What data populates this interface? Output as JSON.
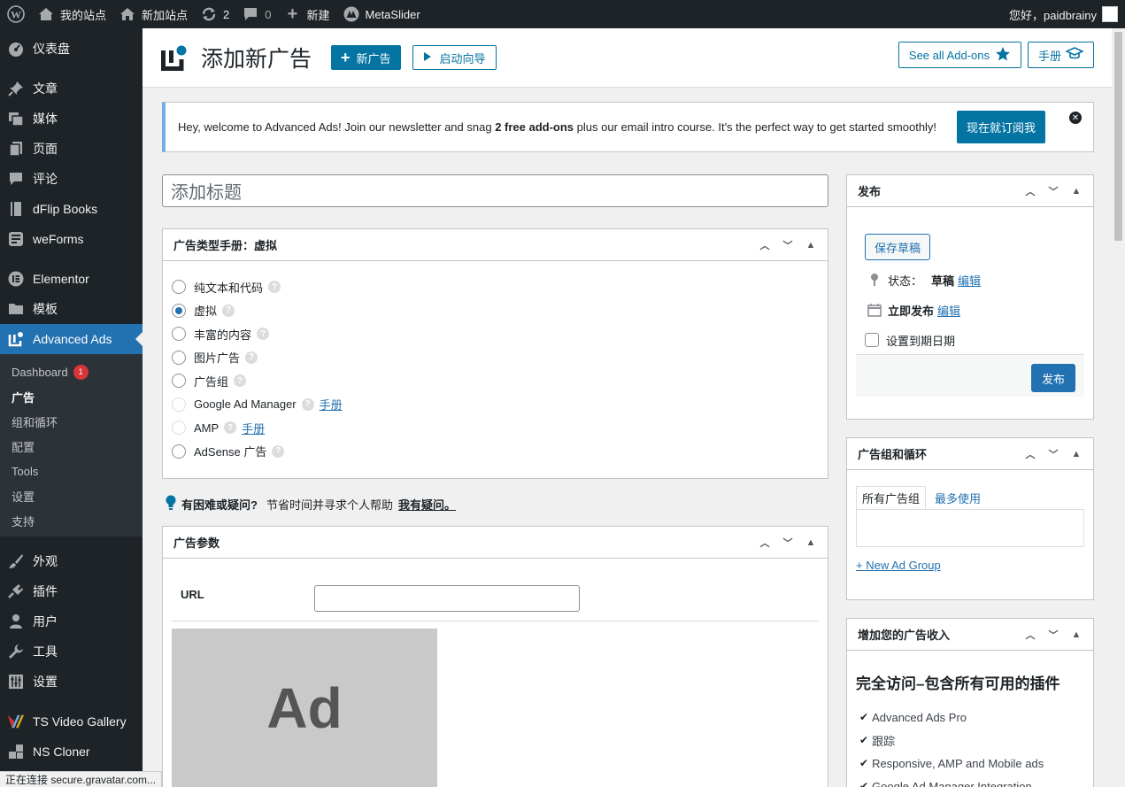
{
  "adminbar": {
    "site_name": "我的站点",
    "new_site": "新加站点",
    "updates": "2",
    "comments": "0",
    "new": "新建",
    "metaslider": "MetaSlider",
    "greeting": "您好，paidbrainy"
  },
  "sidebar": {
    "items": [
      {
        "label": "仪表盘",
        "icon": "dashboard-icon"
      },
      {
        "label": "文章",
        "icon": "pin-icon"
      },
      {
        "label": "媒体",
        "icon": "media-icon"
      },
      {
        "label": "页面",
        "icon": "page-icon"
      },
      {
        "label": "评论",
        "icon": "comment-icon"
      },
      {
        "label": "dFlip Books",
        "icon": "book-icon"
      },
      {
        "label": "weForms",
        "icon": "forms-icon"
      },
      {
        "label": "Elementor",
        "icon": "elementor-icon"
      },
      {
        "label": "模板",
        "icon": "folder-icon"
      },
      {
        "label": "Advanced Ads",
        "icon": "advanced-ads-icon"
      }
    ],
    "submenu": [
      {
        "label": "Dashboard",
        "badge": "1"
      },
      {
        "label": "广告"
      },
      {
        "label": "组和循环"
      },
      {
        "label": "配置"
      },
      {
        "label": "Tools"
      },
      {
        "label": "设置"
      },
      {
        "label": "支持"
      }
    ],
    "items2": [
      {
        "label": "外观",
        "icon": "brush-icon"
      },
      {
        "label": "插件",
        "icon": "plugin-icon"
      },
      {
        "label": "用户",
        "icon": "user-icon"
      },
      {
        "label": "工具",
        "icon": "wrench-icon"
      },
      {
        "label": "设置",
        "icon": "settings-icon"
      },
      {
        "label": "TS Video Gallery",
        "icon": "video-gallery-icon"
      },
      {
        "label": "NS Cloner",
        "icon": "cloner-icon"
      }
    ]
  },
  "header": {
    "title": "添加新广告",
    "new_ad": "新广告",
    "wizard": "启动向导",
    "addons": "See all Add-ons",
    "manual": "手册"
  },
  "notice": {
    "text_pre": "Hey, welcome to Advanced Ads! Join our newsletter and snag ",
    "text_bold": "2 free add-ons",
    "text_post": " plus our email intro course. It's the perfect way to get started smoothly!",
    "button": "现在就订阅我"
  },
  "title_placeholder": "添加标题",
  "ad_type": {
    "heading": "广告类型手册：虚拟",
    "options": [
      {
        "label": "纯文本和代码",
        "state": "unchecked"
      },
      {
        "label": "虚拟",
        "state": "checked"
      },
      {
        "label": "丰富的内容",
        "state": "unchecked"
      },
      {
        "label": "图片广告",
        "state": "unchecked"
      },
      {
        "label": "广告组",
        "state": "unchecked"
      },
      {
        "label": "Google Ad Manager",
        "state": "disabled",
        "link": "手册"
      },
      {
        "label": "AMP",
        "state": "disabled",
        "link": "手册"
      },
      {
        "label": "AdSense 广告",
        "state": "unchecked"
      }
    ]
  },
  "hint": {
    "bold": "有困难或疑问?",
    "text": "节省时间并寻求个人帮助",
    "link": "我有疑问。"
  },
  "ad_params": {
    "heading": "广告参数",
    "url_label": "URL",
    "url_value": "",
    "placeholder_text": "Ad"
  },
  "publish": {
    "heading": "发布",
    "save_draft": "保存草稿",
    "status_label": "状态：",
    "status_value": "草稿",
    "edit": "编辑",
    "publish_now": "立即发布",
    "expiry": "设置到期日期",
    "publish_btn": "发布"
  },
  "groups": {
    "heading": "广告组和循环",
    "tab_all": "所有广告组",
    "tab_recent": "最多使用",
    "new_group": "+ New Ad Group"
  },
  "revenue": {
    "heading": "增加您的广告收入",
    "subheading": "完全访问–包含所有可用的插件",
    "features": [
      "Advanced Ads Pro",
      "跟踪",
      "Responsive, AMP and Mobile ads",
      "Google Ad Manager Integration"
    ]
  },
  "statusbar": "正在连接 secure.gravatar.com..."
}
